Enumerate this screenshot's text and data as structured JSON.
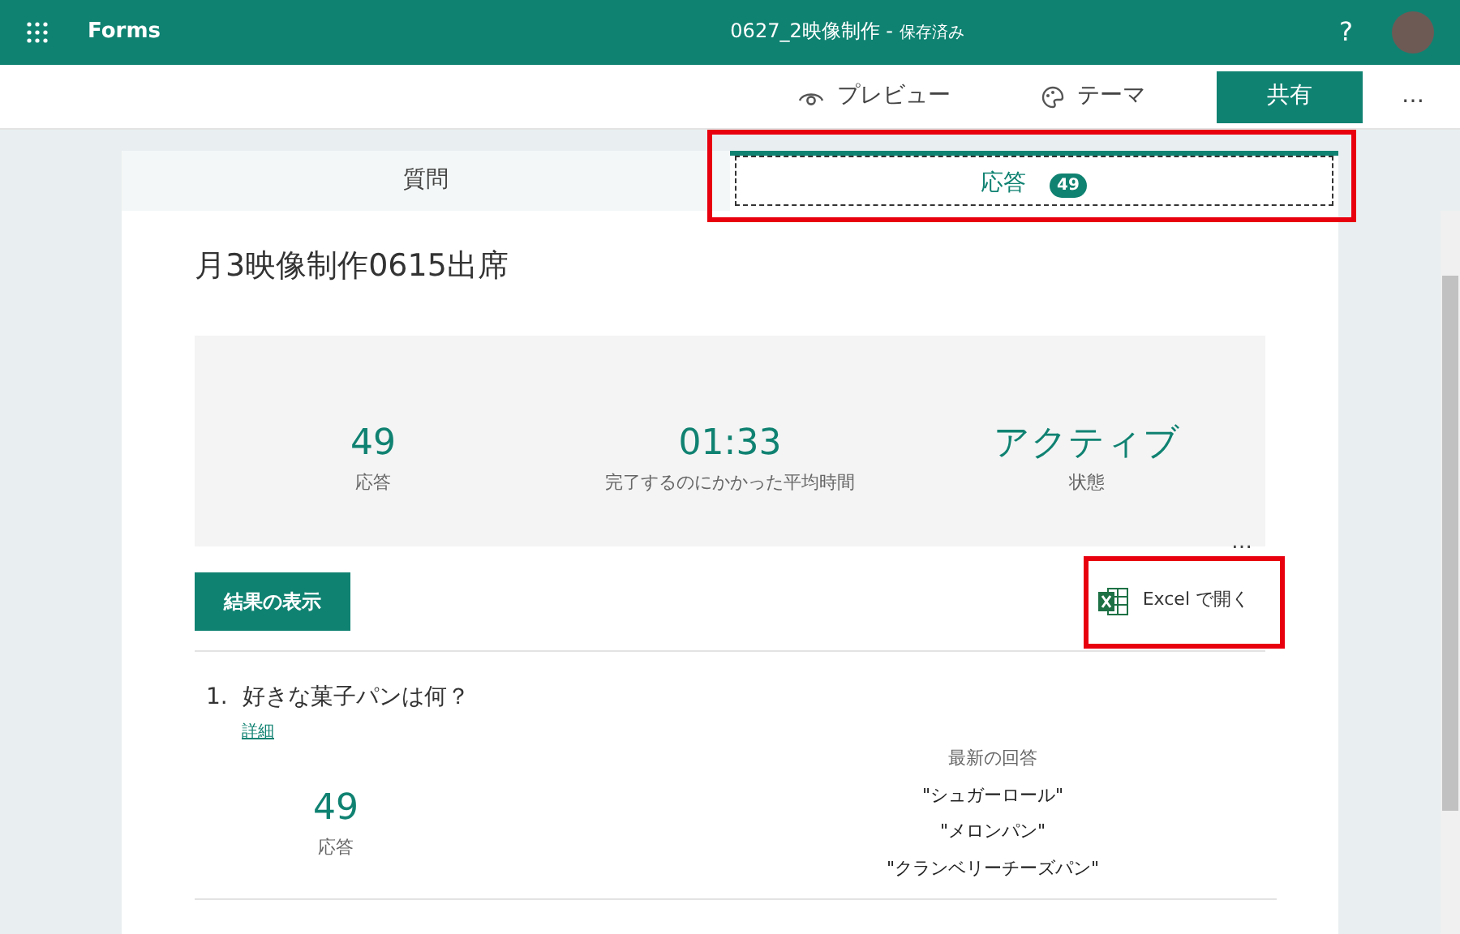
{
  "app": {
    "name": "Forms",
    "document_title": "0627_2映像制作",
    "title_separator": "-",
    "save_status": "保存済み",
    "help": "?"
  },
  "toolbar": {
    "preview": "プレビュー",
    "theme": "テーマ",
    "share": "共有",
    "more": "…"
  },
  "tabs": [
    {
      "label": "質問",
      "selected": false,
      "highlighted": false
    },
    {
      "label": "応答",
      "count": "49",
      "selected": true,
      "highlighted": true
    }
  ],
  "form_title": "月3映像制作0615出席",
  "stats": [
    {
      "value": "49",
      "label": "応答"
    },
    {
      "value": "01:33",
      "label": "完了するのにかかった平均時間"
    },
    {
      "value": "アクティブ",
      "label": "状態"
    }
  ],
  "stats_more": "…",
  "view_results": "結果の表示",
  "open_excel": {
    "label": "Excel で開く",
    "highlighted": true
  },
  "questions": [
    {
      "number": "1.",
      "text": "好きな菓子パンは何？",
      "details": "詳細",
      "count": "49",
      "count_label": "応答",
      "latest_label": "最新の回答",
      "latest": [
        "\"シュガーロール\"",
        "\"メロンパン\"",
        "\"クランベリーチーズパン\""
      ]
    }
  ]
}
